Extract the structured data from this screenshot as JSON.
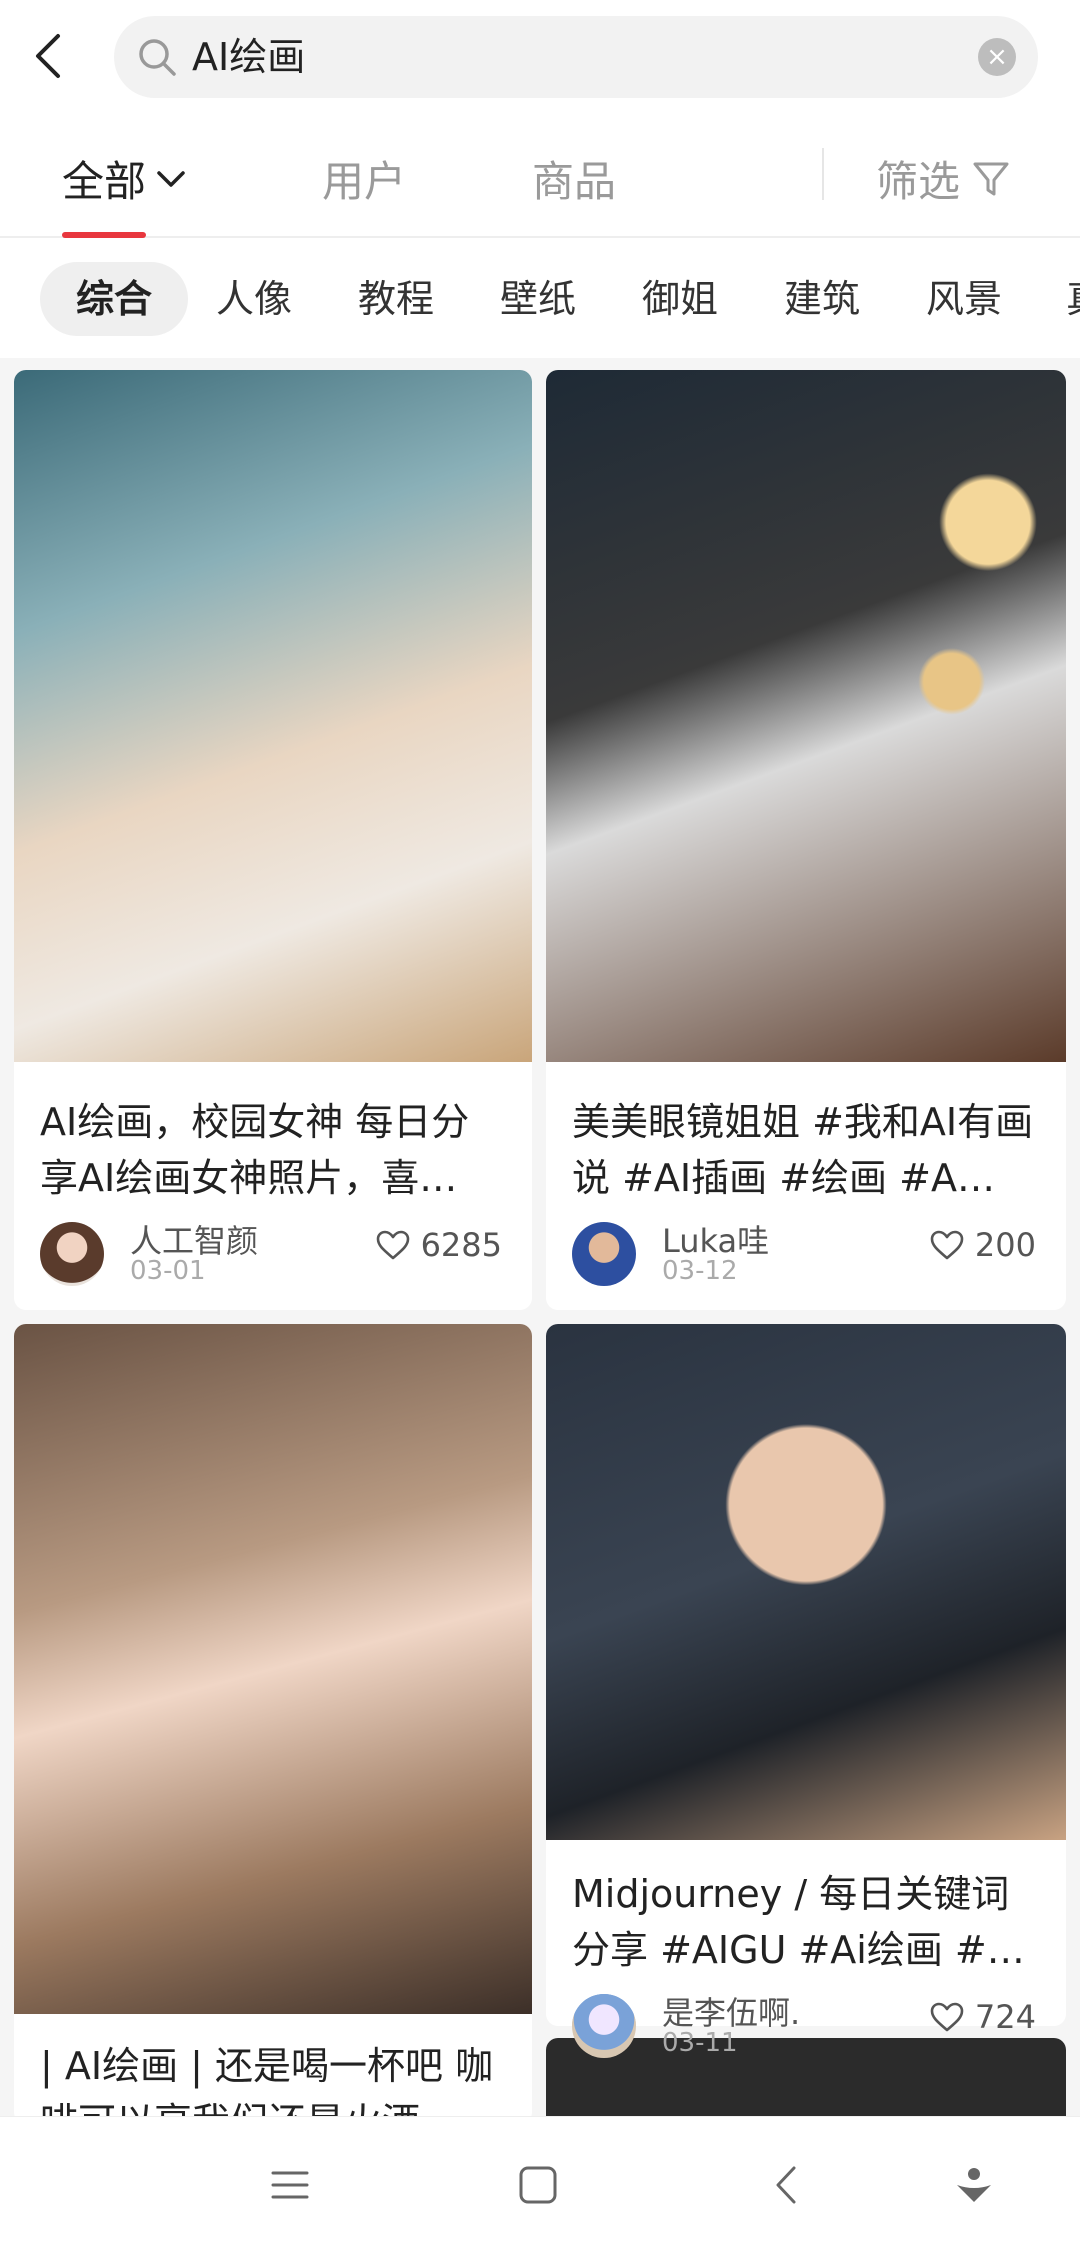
{
  "search": {
    "query": "AI绘画"
  },
  "tabs": {
    "all": "全部",
    "users": "用户",
    "goods": "商品",
    "filter": "筛选"
  },
  "chips": [
    "综合",
    "人像",
    "教程",
    "壁纸",
    "御姐",
    "建筑",
    "风景",
    "真"
  ],
  "cards": [
    {
      "title": "AI绘画，校园女神 每日分享AI绘画女神照片，喜…",
      "author": "人工智颜",
      "date": "03-01",
      "likes": "6285"
    },
    {
      "title": "美美眼镜姐姐 #我和AI有画说 #AI插画 #绘画 #A…",
      "author": "Luka哇",
      "date": "03-12",
      "likes": "200"
    },
    {
      "title": "| AI绘画 | 还是喝一杯吧 咖啡可以享我们还是火酒…"
    },
    {
      "title": "Midjourney / 每日关键词分享 #AIGU #Ai绘画 #…",
      "author": "是李伍啊.",
      "date": "03-11",
      "likes": "724"
    }
  ],
  "colors": {
    "accent": "#e8373e"
  }
}
